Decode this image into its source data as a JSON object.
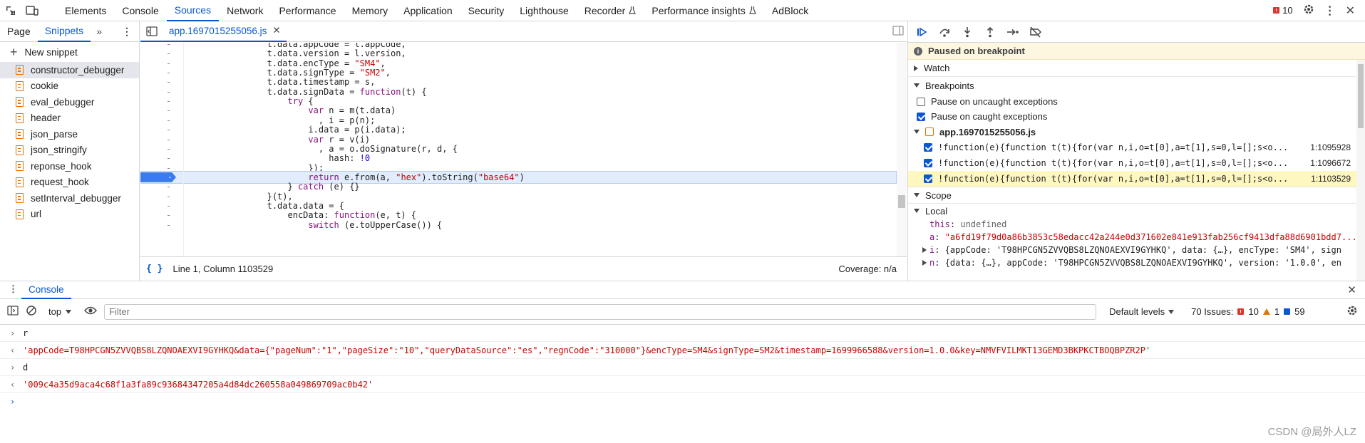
{
  "topbar": {
    "tabs": [
      "Elements",
      "Console",
      "Sources",
      "Network",
      "Performance",
      "Memory",
      "Application",
      "Security",
      "Lighthouse",
      "Recorder",
      "Performance insights",
      "AdBlock"
    ],
    "active_tab": "Sources",
    "issues_count": "10"
  },
  "navigator": {
    "tabs": [
      "Page",
      "Snippets"
    ],
    "active_tab": "Snippets",
    "new_snippet": "New snippet",
    "snippets": [
      "constructor_debugger",
      "cookie",
      "eval_debugger",
      "header",
      "json_parse",
      "json_stringify",
      "reponse_hook",
      "request_hook",
      "setInterval_debugger",
      "url"
    ],
    "selected": "constructor_debugger"
  },
  "editor": {
    "file_tab": "app.1697015255056.js",
    "gutter_mark": "-",
    "lines": [
      "                t.data.appCode = l.appCode,",
      "                t.data.version = l.version,",
      "                t.data.encType = \"SM4\",",
      "                t.data.signType = \"SM2\",",
      "                t.data.timestamp = s,",
      "                t.data.signData = function(t) {",
      "                    try {",
      "                        var n = m(t.data)",
      "                          , i = p(n);",
      "                        i.data = p(i.data);",
      "                        var r = v(i)",
      "                          , a = o.doSignature(r, d, {",
      "                            hash: !0",
      "                        });",
      "                        return e.from(a, \"hex\").toString(\"base64\")",
      "                    } catch (e) {}",
      "                }(t),",
      "                t.data.data = {",
      "                    encData: function(e, t) {",
      "                        switch (e.toUpperCase()) {"
    ],
    "active_line_index": 14,
    "status_position": "Line 1, Column 1103529",
    "coverage": "Coverage: n/a"
  },
  "debugger": {
    "paused_message": "Paused on breakpoint",
    "watch_label": "Watch",
    "breakpoints_label": "Breakpoints",
    "pause_uncaught": "Pause on uncaught exceptions",
    "pause_caught": "Pause on caught exceptions",
    "bp_file": "app.1697015255056.js",
    "breakpoints": [
      {
        "code": "!function(e){function t(t){for(var n,i,o=t[0],a=t[1],s=0,l=[];s<o...",
        "loc": "1:1095928"
      },
      {
        "code": "!function(e){function t(t){for(var n,i,o=t[0],a=t[1],s=0,l=[];s<o...",
        "loc": "1:1096672"
      },
      {
        "code": "!function(e){function t(t){for(var n,i,o=t[0],a=t[1],s=0,l=[];s<o...",
        "loc": "1:1103529"
      }
    ],
    "scope_label": "Scope",
    "local_label": "Local",
    "scope_vars": [
      {
        "name": "this",
        "value": "undefined"
      },
      {
        "name": "a",
        "value": "\"a6fd19f79d0a86b3853c58edacc42a244e0d371602e841e913fab256cf9413dfa88d6901bdd7..."
      },
      {
        "name": "i",
        "value": "{appCode: 'T98HPCGN5ZVVQBS8LZQNOAEXVI9GYHKQ', data: {…}, encType: 'SM4', sign"
      },
      {
        "name": "n",
        "value": "{data: {…}, appCode: 'T98HPCGN5ZVVQBS8LZQNOAEXVI9GYHKQ', version: '1.0.0', en"
      }
    ]
  },
  "drawer": {
    "tab": "Console",
    "context": "top",
    "filter_placeholder": "Filter",
    "levels": "Default levels",
    "issues_label": "70 Issues:",
    "issues_errors": "10",
    "issues_warnings": "1",
    "issues_info": "59"
  },
  "console": {
    "entries": [
      {
        "kind": "input",
        "text": "r"
      },
      {
        "kind": "output",
        "text": "'appCode=T98HPCGN5ZVVQBS8LZQNOAEXVI9GYHKQ&data={\"pageNum\":\"1\",\"pageSize\":\"10\",\"queryDataSource\":\"es\",\"regnCode\":\"310000\"}&encType=SM4&signType=SM2&timestamp=1699966588&version=1.0.0&key=NMVFVILMKT13GEMD3BKPKCTBOQBPZR2P'"
      },
      {
        "kind": "input",
        "text": "d"
      },
      {
        "kind": "output",
        "text": "'009c4a35d9aca4c68f1a3fa89c93684347205a4d84dc260558a049869709ac0b42'"
      }
    ]
  },
  "watermark": "CSDN @局外人LZ",
  "colors": {
    "accent": "#0b57d0",
    "string": "#c80000",
    "keyword": "#881280",
    "paused_bg": "#fef7e0"
  }
}
